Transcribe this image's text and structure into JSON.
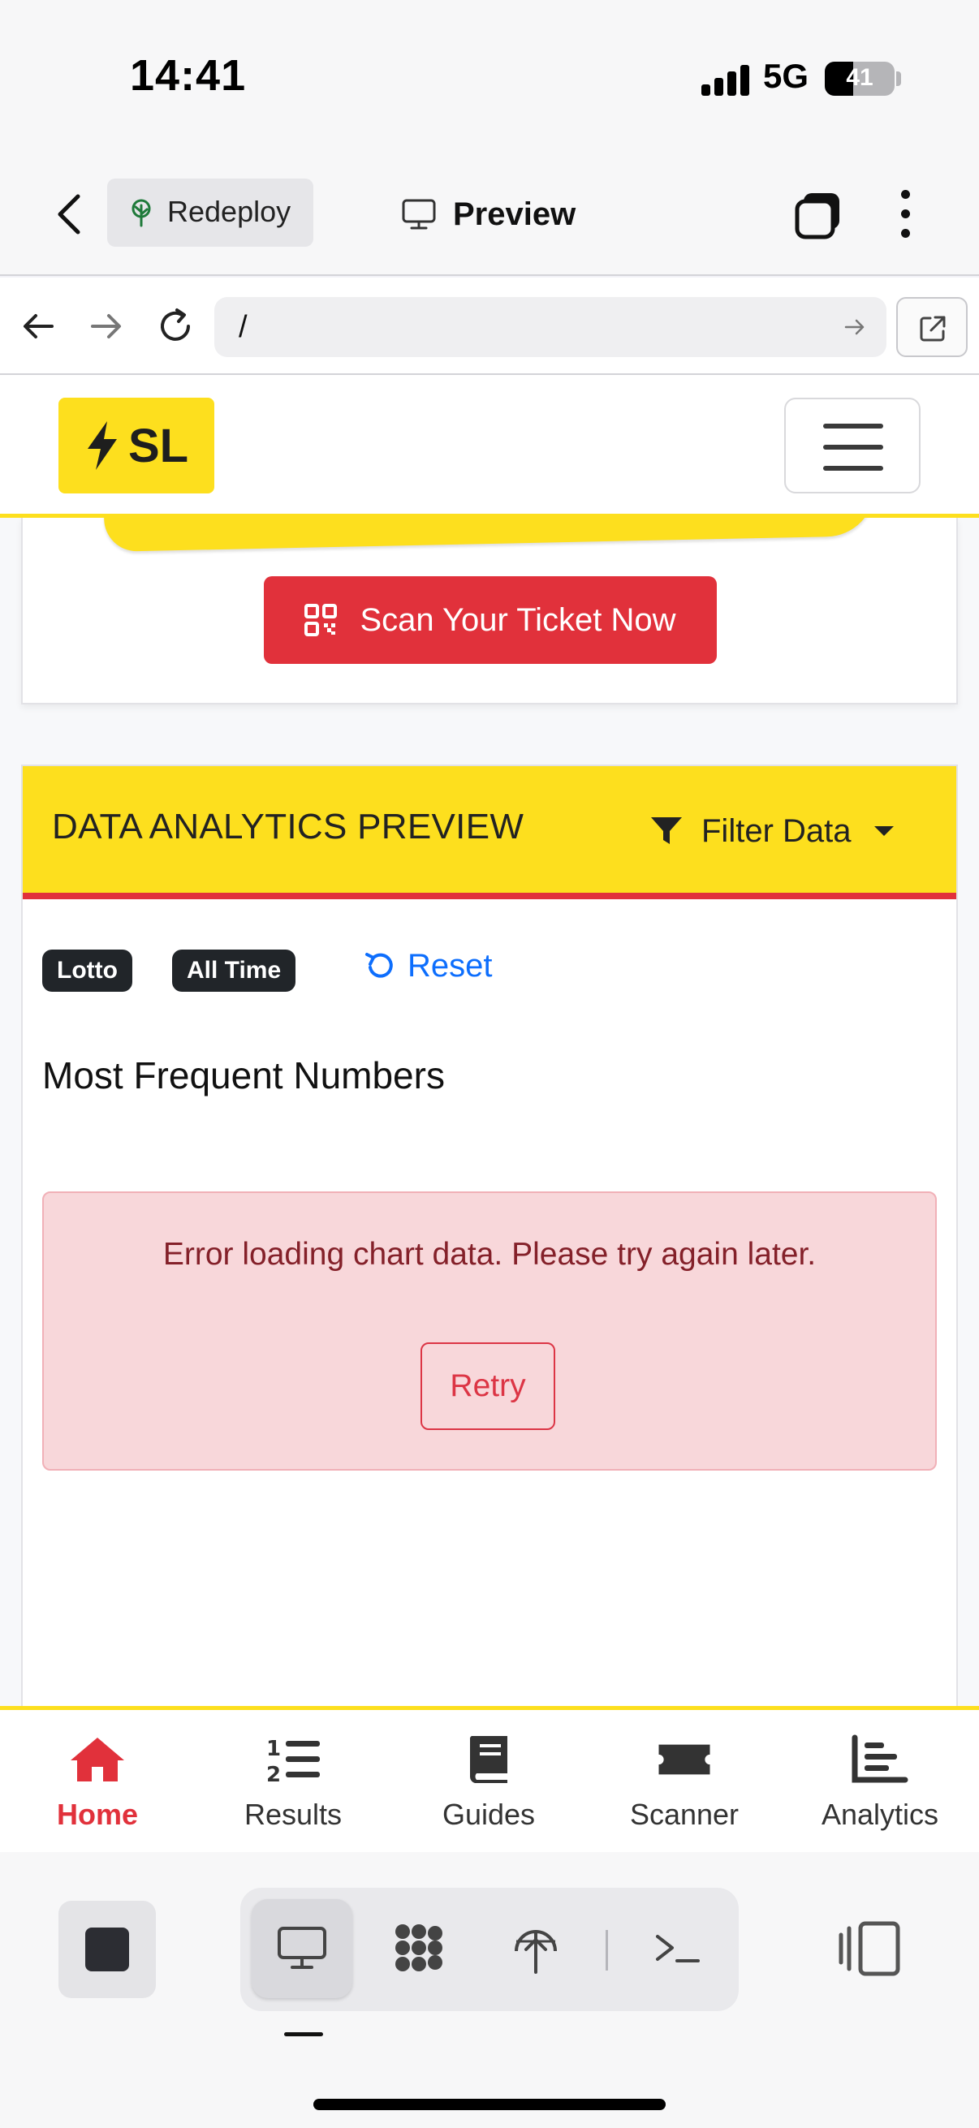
{
  "status_bar": {
    "time": "14:41",
    "network": "5G",
    "battery": "41",
    "battery_level": 0.41
  },
  "app_bar": {
    "redeploy_label": "Redeploy",
    "preview_label": "Preview"
  },
  "browser": {
    "url": "/"
  },
  "site": {
    "brand_text": "SL",
    "scan_button_label": "Scan Your Ticket Now",
    "analytics": {
      "title": "DATA ANALYTICS PREVIEW",
      "filter_label": "Filter Data",
      "badges": [
        "Lotto",
        "All Time"
      ],
      "reset_label": "Reset",
      "section_title": "Most Frequent Numbers",
      "error_message": "Error loading chart data. Please try again later.",
      "retry_label": "Retry"
    }
  },
  "tab_nav": {
    "items": [
      {
        "label": "Home",
        "icon": "home-icon",
        "active": true
      },
      {
        "label": "Results",
        "icon": "numbered-list-icon"
      },
      {
        "label": "Guides",
        "icon": "book-icon"
      },
      {
        "label": "Scanner",
        "icon": "ticket-icon"
      },
      {
        "label": "Analytics",
        "icon": "bar-chart-icon"
      }
    ]
  },
  "colors": {
    "brand_yellow": "#fddf1e",
    "accent_red": "#e1313b",
    "link_blue": "#0d6efd",
    "error_bg": "#f8d7da",
    "error_text": "#842029"
  }
}
